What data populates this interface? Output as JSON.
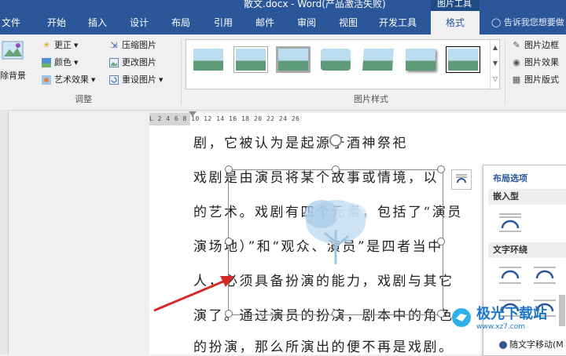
{
  "titlebar": {
    "title": "散文.docx - Word(产品激活失败)",
    "context_tab": "图片工具"
  },
  "tabs": [
    {
      "label": "文件"
    },
    {
      "label": "开始"
    },
    {
      "label": "插入"
    },
    {
      "label": "设计"
    },
    {
      "label": "布局"
    },
    {
      "label": "引用"
    },
    {
      "label": "邮件"
    },
    {
      "label": "审阅"
    },
    {
      "label": "视图"
    },
    {
      "label": "开发工具"
    },
    {
      "label": "格式"
    }
  ],
  "tell_me": "告诉我您想要做",
  "ribbon": {
    "remove_bg": "除背景",
    "corrections": "更正",
    "color": "颜色",
    "artistic": "艺术效果",
    "compress": "压缩图片",
    "change": "更改图片",
    "reset": "重设图片",
    "adjust_group": "调整",
    "styles_group": "图片样式",
    "border": "图片边框",
    "effects": "图片效果",
    "layout": "图片版式"
  },
  "ruler_marks": "L 2  4  6  8  10  12  14  16  18  20  22  24  26",
  "document": {
    "lines": [
      "剧，它被认为是起源于酒神祭祀",
      "戏剧是由演员将某个故事或情境，以",
      "的艺术。戏剧有四个元素，包括了“演员",
      "演场地）”和“观众、演员”是四者当中",
      "人，必须具备扮演的能力，戏剧与其它",
      "演了。通过演员的扮演，剧本中的角色",
      "的扮演，那么所演出的便不再是戏剧。"
    ]
  },
  "layout_options": {
    "title": "布局选项",
    "inline_section": "嵌入型",
    "wrap_section": "文字环绕",
    "move_with_text": "随文字移动(M"
  },
  "watermark": {
    "text": "极光下载站",
    "sub": "www.xz7.com"
  },
  "colors": {
    "brand": "#2b579a",
    "arrow": "#d42a2a"
  }
}
